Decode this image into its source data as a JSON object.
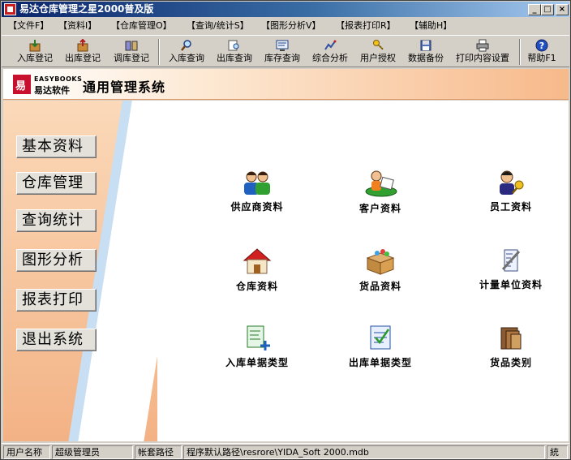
{
  "window": {
    "title": "易达仓库管理之星2000普及版",
    "controls": {
      "minimize": "_",
      "maximize": "□",
      "close": "×"
    }
  },
  "menu": [
    {
      "label": "【文件F】"
    },
    {
      "label": "【资料I】"
    },
    {
      "label": "【仓库管理O】"
    },
    {
      "label": "【查询/统计S】"
    },
    {
      "label": "【图形分析V】"
    },
    {
      "label": "【报表打印R】"
    },
    {
      "label": "【辅助H】"
    }
  ],
  "toolbar": [
    {
      "label": "入库登记",
      "icon": "stock-in-icon"
    },
    {
      "label": "出库登记",
      "icon": "stock-out-icon"
    },
    {
      "label": "调库登记",
      "icon": "transfer-icon"
    },
    {
      "label": "入库查询",
      "icon": "search-icon"
    },
    {
      "label": "出库查询",
      "icon": "search-icon"
    },
    {
      "label": "库存查询",
      "icon": "inventory-icon"
    },
    {
      "label": "综合分析",
      "icon": "analysis-icon"
    },
    {
      "label": "用户授权",
      "icon": "key-icon"
    },
    {
      "label": "数据备份",
      "icon": "backup-icon"
    },
    {
      "label": "打印内容设置",
      "icon": "printer-icon"
    },
    {
      "label": "帮助F1",
      "icon": "help-icon"
    }
  ],
  "banner": {
    "logo_en": "EASYBOOKS",
    "logo_cn": "易达软件",
    "title": "通用管理系统"
  },
  "nav": [
    {
      "label": "基本资料"
    },
    {
      "label": "仓库管理"
    },
    {
      "label": "查询统计"
    },
    {
      "label": "图形分析"
    },
    {
      "label": "报表打印"
    },
    {
      "label": "退出系统"
    }
  ],
  "tiles": [
    {
      "label": "供应商资料",
      "icon": "supplier-icon"
    },
    {
      "label": "客户资料",
      "icon": "customer-icon"
    },
    {
      "label": "员工资料",
      "icon": "employee-icon"
    },
    {
      "label": "仓库资料",
      "icon": "warehouse-icon"
    },
    {
      "label": "货品资料",
      "icon": "goods-box-icon"
    },
    {
      "label": "计量单位资料",
      "icon": "measure-unit-icon"
    },
    {
      "label": "入库单据类型",
      "icon": "inbound-doc-icon"
    },
    {
      "label": "出库单据类型",
      "icon": "outbound-doc-icon"
    },
    {
      "label": "货品类别",
      "icon": "goods-category-icon"
    }
  ],
  "status": {
    "user_label": "用户名称",
    "user_value": "超级管理员",
    "path_label": "帐套路径",
    "path_value": "程序默认路径\\resrore\\YIDA_Soft 2000.mdb",
    "extra": "統"
  },
  "colors": {
    "title_bar": "#0a246a",
    "banner_accent": "#f7b98a",
    "left_panel": "#f6c29a",
    "swoosh": "#c8def2"
  }
}
